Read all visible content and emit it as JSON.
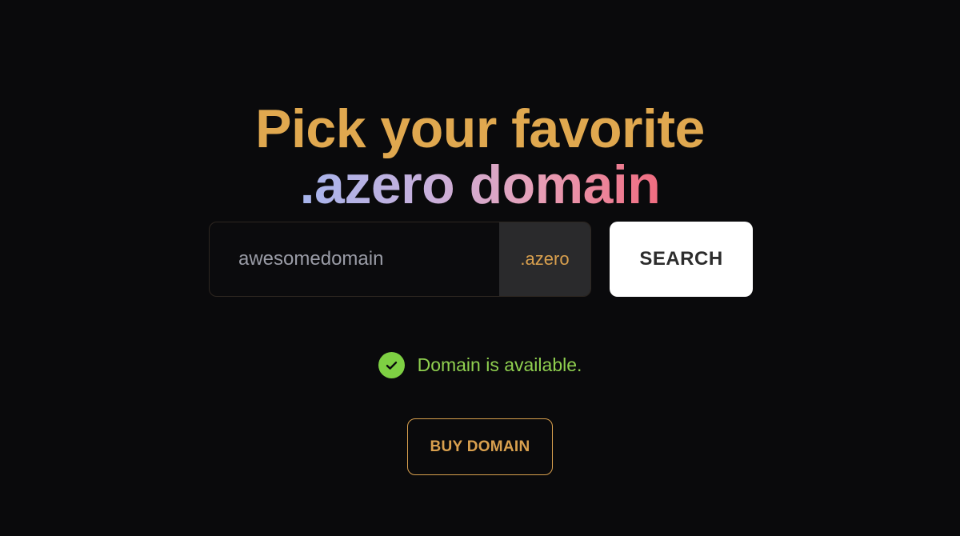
{
  "headline": {
    "line1": "Pick your favorite",
    "line2": ".azero domain"
  },
  "search": {
    "input_value": "awesomedomain",
    "tld": ".azero",
    "button_label": "SEARCH"
  },
  "status": {
    "icon": "check-circle-icon",
    "text": "Domain is available."
  },
  "buy": {
    "button_label": "BUY DOMAIN"
  },
  "colors": {
    "background": "#0a0a0c",
    "accent_gold": "#e0a84f",
    "gradient_start": "#a6b4ec",
    "gradient_end": "#f06c80",
    "success_green": "#7ed043"
  }
}
